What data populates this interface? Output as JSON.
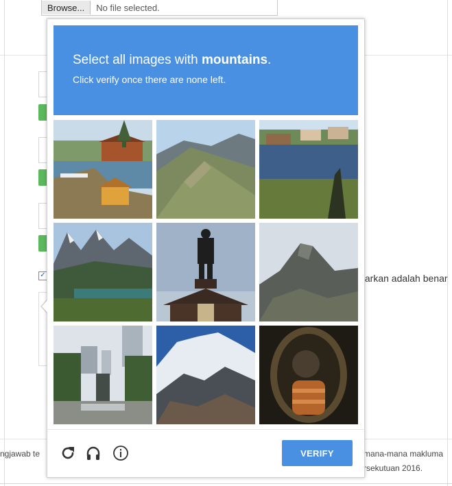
{
  "file_input": {
    "button_label": "Browse...",
    "status": "No file selected."
  },
  "background": {
    "agreement_text": "tarkan adalah benar",
    "footer_left": "ngjawab te",
    "footer_right_1": "mana-mana makluma",
    "footer_right_2": "rsekutuan 2016."
  },
  "captcha": {
    "prompt_prefix": "Select all images with ",
    "prompt_keyword": "mountains",
    "prompt_suffix": ".",
    "subtitle": "Click verify once there are none left.",
    "header_color": "#4a90e2",
    "tiles": [
      {
        "subject": "lakeside-houses"
      },
      {
        "subject": "mountain-ridge"
      },
      {
        "subject": "pond-with-houses"
      },
      {
        "subject": "alpine-lake-mountains"
      },
      {
        "subject": "statue-silhouette"
      },
      {
        "subject": "rocky-mountain-peak"
      },
      {
        "subject": "city-skyline-fountain"
      },
      {
        "subject": "snowy-mountain"
      },
      {
        "subject": "bronze-statue-closeup"
      }
    ],
    "icons": [
      "reload-icon",
      "audio-icon",
      "info-icon"
    ],
    "verify_label": "VERIFY"
  }
}
